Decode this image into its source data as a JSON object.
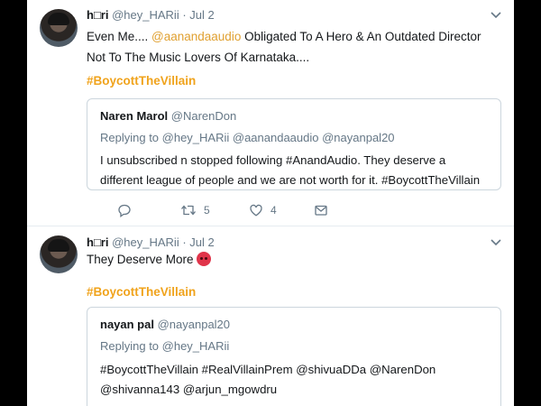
{
  "tweets": [
    {
      "author_name": "h□ri",
      "handle": "@hey_HARii",
      "date": "· Jul 2",
      "text_before": "Even Me.... ",
      "mention": "@aanandaaudio",
      "text_after": " Obligated To A Hero & An Outdated Director Not To The Music Lovers Of Karnataka....",
      "hashtag": "#BoycottTheVillain",
      "quote": {
        "name": "Naren Marol",
        "handle": "@NarenDon",
        "replying": "Replying to @hey_HARii @aanandaaudio @nayanpal20",
        "text": "I unsubscribed n stopped following #AnandAudio. They deserve a different league of people and we are not worth for it. #BoycottTheVillain"
      },
      "actions": {
        "retweets": "5",
        "likes": "4"
      }
    },
    {
      "author_name": "h□ri",
      "handle": "@hey_HARii",
      "date": "· Jul 2",
      "text": "They Deserve More",
      "emoji_icon": "angry-face-emoji",
      "hashtag": "#BoycottTheVillain",
      "quote": {
        "name": "nayan pal",
        "handle": "@nayanpal20",
        "replying": "Replying to @hey_HARii",
        "text": "#BoycottTheVillain #RealVillainPrem @shivuaDDa @NarenDon @shivanna143 @arjun_mgowdru"
      }
    }
  ],
  "colors": {
    "hashtag": "#f0a31c",
    "mention": "#e0a030",
    "muted": "#657786",
    "text": "#14171a",
    "border": "#ccd6dd"
  }
}
